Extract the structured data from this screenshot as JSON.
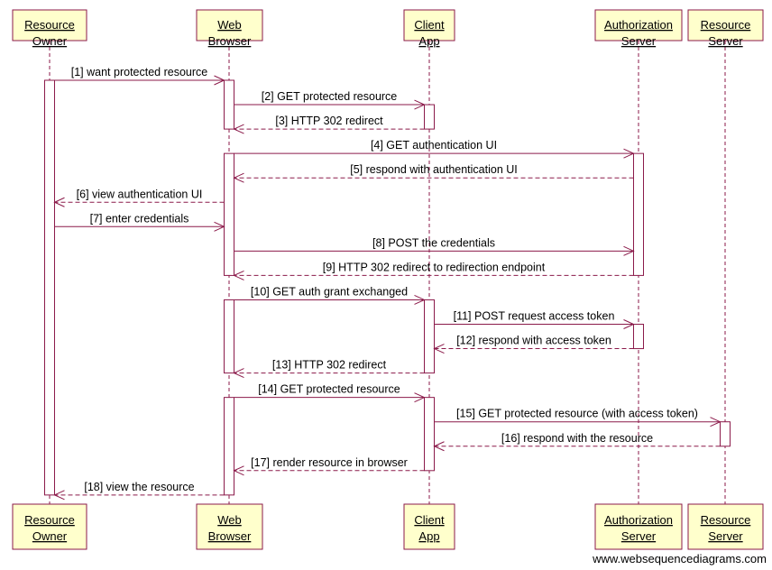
{
  "colors": {
    "line": "#8b1a4a",
    "box_fill": "#ffffcc",
    "box_border": "#8b1a4a"
  },
  "participants": [
    {
      "id": "ro",
      "lines": [
        "Resource",
        "Owner"
      ]
    },
    {
      "id": "wb",
      "lines": [
        "Web",
        "Browser"
      ]
    },
    {
      "id": "ca",
      "lines": [
        "Client",
        "App"
      ]
    },
    {
      "id": "as",
      "lines": [
        "Authorization",
        "Server"
      ]
    },
    {
      "id": "rs",
      "lines": [
        "Resource",
        "Server"
      ]
    }
  ],
  "messages": [
    {
      "label": "[1] want protected resource",
      "from": "ro",
      "to": "wb",
      "dashed": false
    },
    {
      "label": "[2] GET protected resource",
      "from": "wb",
      "to": "ca",
      "dashed": false
    },
    {
      "label": "[3] HTTP 302 redirect",
      "from": "ca",
      "to": "wb",
      "dashed": true
    },
    {
      "label": "[4] GET authentication UI",
      "from": "wb",
      "to": "as",
      "dashed": false
    },
    {
      "label": "[5] respond with authentication UI",
      "from": "as",
      "to": "wb",
      "dashed": true
    },
    {
      "label": "[6] view authentication UI",
      "from": "wb",
      "to": "ro",
      "dashed": true
    },
    {
      "label": "[7] enter credentials",
      "from": "ro",
      "to": "wb",
      "dashed": false
    },
    {
      "label": "[8] POST the credentials",
      "from": "wb",
      "to": "as",
      "dashed": false
    },
    {
      "label": "[9] HTTP 302 redirect to redirection endpoint",
      "from": "as",
      "to": "wb",
      "dashed": true
    },
    {
      "label": "[10] GET auth grant exchanged",
      "from": "wb",
      "to": "ca",
      "dashed": false
    },
    {
      "label": "[11] POST request access token",
      "from": "ca",
      "to": "as",
      "dashed": false
    },
    {
      "label": "[12] respond with access token",
      "from": "as",
      "to": "ca",
      "dashed": true
    },
    {
      "label": "[13] HTTP 302 redirect",
      "from": "ca",
      "to": "wb",
      "dashed": true
    },
    {
      "label": "[14] GET protected resource",
      "from": "wb",
      "to": "ca",
      "dashed": false
    },
    {
      "label": "[15] GET protected resource (with access token)",
      "from": "ca",
      "to": "rs",
      "dashed": false
    },
    {
      "label": "[16] respond with the resource",
      "from": "rs",
      "to": "ca",
      "dashed": true
    },
    {
      "label": "[17] render resource in browser",
      "from": "ca",
      "to": "wb",
      "dashed": true
    },
    {
      "label": "[18] view the resource",
      "from": "wb",
      "to": "ro",
      "dashed": true
    }
  ],
  "activations": [
    {
      "participant": "ro",
      "from_message": 1,
      "to_message": 18
    },
    {
      "participant": "wb",
      "from_message": 1,
      "to_message": 3
    },
    {
      "participant": "wb",
      "from_message": 4,
      "to_message": 9
    },
    {
      "participant": "wb",
      "from_message": 10,
      "to_message": 13
    },
    {
      "participant": "wb",
      "from_message": 14,
      "to_message": 18
    },
    {
      "participant": "ca",
      "from_message": 2,
      "to_message": 3
    },
    {
      "participant": "ca",
      "from_message": 10,
      "to_message": 13
    },
    {
      "participant": "ca",
      "from_message": 14,
      "to_message": 17
    },
    {
      "participant": "as",
      "from_message": 4,
      "to_message": 9
    },
    {
      "participant": "as",
      "from_message": 11,
      "to_message": 12
    },
    {
      "participant": "rs",
      "from_message": 15,
      "to_message": 16
    }
  ],
  "watermark": "www.websequencediagrams.com"
}
